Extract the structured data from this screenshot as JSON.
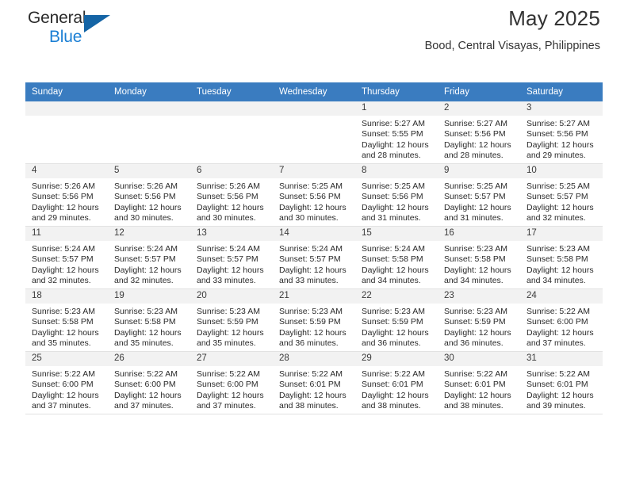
{
  "brand": {
    "name_part1": "General",
    "name_part2": "Blue",
    "mark": "triangle-logo"
  },
  "header": {
    "title": "May 2025",
    "location": "Bood, Central Visayas, Philippines"
  },
  "calendar": {
    "weekday_headers": [
      "Sunday",
      "Monday",
      "Tuesday",
      "Wednesday",
      "Thursday",
      "Friday",
      "Saturday"
    ],
    "colors": {
      "header_bg": "#3a7cc0",
      "header_text": "#ffffff",
      "daynum_bg": "#f2f2f2",
      "grid_line": "#e2e2e2",
      "brand_blue": "#1b7fd4",
      "logo_blue": "#1464a5"
    },
    "weeks": [
      [
        {
          "day": "",
          "sunrise": "",
          "sunset": "",
          "daylight1": "",
          "daylight2": ""
        },
        {
          "day": "",
          "sunrise": "",
          "sunset": "",
          "daylight1": "",
          "daylight2": ""
        },
        {
          "day": "",
          "sunrise": "",
          "sunset": "",
          "daylight1": "",
          "daylight2": ""
        },
        {
          "day": "",
          "sunrise": "",
          "sunset": "",
          "daylight1": "",
          "daylight2": ""
        },
        {
          "day": "1",
          "sunrise": "Sunrise: 5:27 AM",
          "sunset": "Sunset: 5:55 PM",
          "daylight1": "Daylight: 12 hours",
          "daylight2": "and 28 minutes."
        },
        {
          "day": "2",
          "sunrise": "Sunrise: 5:27 AM",
          "sunset": "Sunset: 5:56 PM",
          "daylight1": "Daylight: 12 hours",
          "daylight2": "and 28 minutes."
        },
        {
          "day": "3",
          "sunrise": "Sunrise: 5:27 AM",
          "sunset": "Sunset: 5:56 PM",
          "daylight1": "Daylight: 12 hours",
          "daylight2": "and 29 minutes."
        }
      ],
      [
        {
          "day": "4",
          "sunrise": "Sunrise: 5:26 AM",
          "sunset": "Sunset: 5:56 PM",
          "daylight1": "Daylight: 12 hours",
          "daylight2": "and 29 minutes."
        },
        {
          "day": "5",
          "sunrise": "Sunrise: 5:26 AM",
          "sunset": "Sunset: 5:56 PM",
          "daylight1": "Daylight: 12 hours",
          "daylight2": "and 30 minutes."
        },
        {
          "day": "6",
          "sunrise": "Sunrise: 5:26 AM",
          "sunset": "Sunset: 5:56 PM",
          "daylight1": "Daylight: 12 hours",
          "daylight2": "and 30 minutes."
        },
        {
          "day": "7",
          "sunrise": "Sunrise: 5:25 AM",
          "sunset": "Sunset: 5:56 PM",
          "daylight1": "Daylight: 12 hours",
          "daylight2": "and 30 minutes."
        },
        {
          "day": "8",
          "sunrise": "Sunrise: 5:25 AM",
          "sunset": "Sunset: 5:56 PM",
          "daylight1": "Daylight: 12 hours",
          "daylight2": "and 31 minutes."
        },
        {
          "day": "9",
          "sunrise": "Sunrise: 5:25 AM",
          "sunset": "Sunset: 5:57 PM",
          "daylight1": "Daylight: 12 hours",
          "daylight2": "and 31 minutes."
        },
        {
          "day": "10",
          "sunrise": "Sunrise: 5:25 AM",
          "sunset": "Sunset: 5:57 PM",
          "daylight1": "Daylight: 12 hours",
          "daylight2": "and 32 minutes."
        }
      ],
      [
        {
          "day": "11",
          "sunrise": "Sunrise: 5:24 AM",
          "sunset": "Sunset: 5:57 PM",
          "daylight1": "Daylight: 12 hours",
          "daylight2": "and 32 minutes."
        },
        {
          "day": "12",
          "sunrise": "Sunrise: 5:24 AM",
          "sunset": "Sunset: 5:57 PM",
          "daylight1": "Daylight: 12 hours",
          "daylight2": "and 32 minutes."
        },
        {
          "day": "13",
          "sunrise": "Sunrise: 5:24 AM",
          "sunset": "Sunset: 5:57 PM",
          "daylight1": "Daylight: 12 hours",
          "daylight2": "and 33 minutes."
        },
        {
          "day": "14",
          "sunrise": "Sunrise: 5:24 AM",
          "sunset": "Sunset: 5:57 PM",
          "daylight1": "Daylight: 12 hours",
          "daylight2": "and 33 minutes."
        },
        {
          "day": "15",
          "sunrise": "Sunrise: 5:24 AM",
          "sunset": "Sunset: 5:58 PM",
          "daylight1": "Daylight: 12 hours",
          "daylight2": "and 34 minutes."
        },
        {
          "day": "16",
          "sunrise": "Sunrise: 5:23 AM",
          "sunset": "Sunset: 5:58 PM",
          "daylight1": "Daylight: 12 hours",
          "daylight2": "and 34 minutes."
        },
        {
          "day": "17",
          "sunrise": "Sunrise: 5:23 AM",
          "sunset": "Sunset: 5:58 PM",
          "daylight1": "Daylight: 12 hours",
          "daylight2": "and 34 minutes."
        }
      ],
      [
        {
          "day": "18",
          "sunrise": "Sunrise: 5:23 AM",
          "sunset": "Sunset: 5:58 PM",
          "daylight1": "Daylight: 12 hours",
          "daylight2": "and 35 minutes."
        },
        {
          "day": "19",
          "sunrise": "Sunrise: 5:23 AM",
          "sunset": "Sunset: 5:58 PM",
          "daylight1": "Daylight: 12 hours",
          "daylight2": "and 35 minutes."
        },
        {
          "day": "20",
          "sunrise": "Sunrise: 5:23 AM",
          "sunset": "Sunset: 5:59 PM",
          "daylight1": "Daylight: 12 hours",
          "daylight2": "and 35 minutes."
        },
        {
          "day": "21",
          "sunrise": "Sunrise: 5:23 AM",
          "sunset": "Sunset: 5:59 PM",
          "daylight1": "Daylight: 12 hours",
          "daylight2": "and 36 minutes."
        },
        {
          "day": "22",
          "sunrise": "Sunrise: 5:23 AM",
          "sunset": "Sunset: 5:59 PM",
          "daylight1": "Daylight: 12 hours",
          "daylight2": "and 36 minutes."
        },
        {
          "day": "23",
          "sunrise": "Sunrise: 5:23 AM",
          "sunset": "Sunset: 5:59 PM",
          "daylight1": "Daylight: 12 hours",
          "daylight2": "and 36 minutes."
        },
        {
          "day": "24",
          "sunrise": "Sunrise: 5:22 AM",
          "sunset": "Sunset: 6:00 PM",
          "daylight1": "Daylight: 12 hours",
          "daylight2": "and 37 minutes."
        }
      ],
      [
        {
          "day": "25",
          "sunrise": "Sunrise: 5:22 AM",
          "sunset": "Sunset: 6:00 PM",
          "daylight1": "Daylight: 12 hours",
          "daylight2": "and 37 minutes."
        },
        {
          "day": "26",
          "sunrise": "Sunrise: 5:22 AM",
          "sunset": "Sunset: 6:00 PM",
          "daylight1": "Daylight: 12 hours",
          "daylight2": "and 37 minutes."
        },
        {
          "day": "27",
          "sunrise": "Sunrise: 5:22 AM",
          "sunset": "Sunset: 6:00 PM",
          "daylight1": "Daylight: 12 hours",
          "daylight2": "and 37 minutes."
        },
        {
          "day": "28",
          "sunrise": "Sunrise: 5:22 AM",
          "sunset": "Sunset: 6:01 PM",
          "daylight1": "Daylight: 12 hours",
          "daylight2": "and 38 minutes."
        },
        {
          "day": "29",
          "sunrise": "Sunrise: 5:22 AM",
          "sunset": "Sunset: 6:01 PM",
          "daylight1": "Daylight: 12 hours",
          "daylight2": "and 38 minutes."
        },
        {
          "day": "30",
          "sunrise": "Sunrise: 5:22 AM",
          "sunset": "Sunset: 6:01 PM",
          "daylight1": "Daylight: 12 hours",
          "daylight2": "and 38 minutes."
        },
        {
          "day": "31",
          "sunrise": "Sunrise: 5:22 AM",
          "sunset": "Sunset: 6:01 PM",
          "daylight1": "Daylight: 12 hours",
          "daylight2": "and 39 minutes."
        }
      ]
    ]
  }
}
